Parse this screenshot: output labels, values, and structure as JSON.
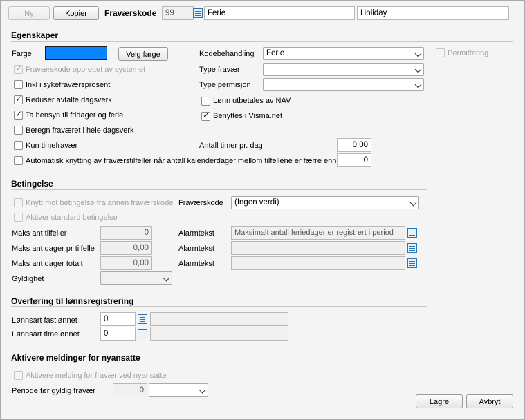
{
  "toolbar": {
    "new_label": "Ny",
    "copy_label": "Kopier",
    "code_label": "Fraværskode",
    "code_value": "99",
    "name_value": "Ferie",
    "name_en_value": "Holiday"
  },
  "properties": {
    "section_title": "Egenskaper",
    "color_label": "Farge",
    "color_value": "#0a84ff",
    "pick_color_label": "Velg farge",
    "code_handling_label": "Kodebehandling",
    "code_handling_value": "Ferie",
    "layoff_label": "Permittering",
    "system_created_label": "Fraværskode opprettet av systemet",
    "absence_type_label": "Type fravær",
    "absence_type_value": "",
    "sick_pct_label": "Inkl i sykefraværsprosent",
    "leave_type_label": "Type permisjon",
    "leave_type_value": "",
    "reduce_days_label": "Reduser avtalte dagsverk",
    "nav_pay_label": "Lønn utbetales av NAV",
    "holidays_label": "Ta hensyn til fridager og ferie",
    "visma_label": "Benyttes i Visma.net",
    "full_day_label": "Beregn fraværet i hele dagsverk",
    "hours_only_label": "Kun timefravær",
    "hours_per_day_label": "Antall timer pr. dag",
    "hours_per_day_value": "0,00",
    "auto_link_label": "Automatisk knytting av fraværstilfeller når antall kalenderdager mellom tilfellene er færre enn",
    "auto_link_value": "0"
  },
  "conditions": {
    "section_title": "Betingelse",
    "link_other_label": "Knytt mot betingelse fra annen fraværskode",
    "code_label": "Fraværskode",
    "code_value": "(Ingen verdi)",
    "activate_std_label": "Aktiver standard betingelse",
    "max_cases_label": "Maks ant tilfeller",
    "max_cases_value": "0",
    "alarm_label_1": "Alarmtekst",
    "alarm_value_1": "Maksimalt antall feriedager er registrert i period",
    "max_days_case_label": "Maks ant dager pr tilfelle",
    "max_days_case_value": "0,00",
    "alarm_label_2": "Alarmtekst",
    "alarm_value_2": "",
    "max_days_total_label": "Maks ant dager totalt",
    "max_days_total_value": "0,00",
    "alarm_label_3": "Alarmtekst",
    "alarm_value_3": "",
    "validity_label": "Gyldighet",
    "validity_value": ""
  },
  "payroll": {
    "section_title": "Overføring til lønnsregistrering",
    "fixed_label": "Lønnsart fastlønnet",
    "fixed_value": "0",
    "fixed_desc": "",
    "hourly_label": "Lønnsart timelønnet",
    "hourly_value": "0",
    "hourly_desc": ""
  },
  "new_hires": {
    "section_title": "Aktivere meldinger for nyansatte",
    "activate_label": "Aktivere melding for fravær ved nyansatte",
    "period_label": "Periode før gyldig fravær",
    "period_value": "0",
    "period_unit": ""
  },
  "footer": {
    "save_label": "Lagre",
    "cancel_label": "Avbryt"
  }
}
